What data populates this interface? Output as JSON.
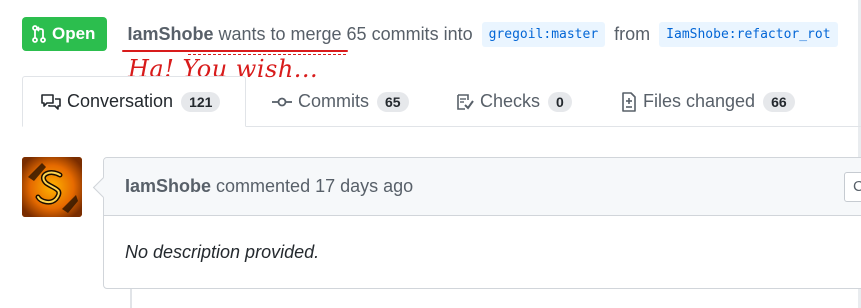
{
  "pr": {
    "state_label": "Open",
    "author": "IamShobe",
    "merge_text": "wants to merge 65 commits into",
    "base_branch": "gregoil:master",
    "from_text": "from",
    "head_branch": "IamShobe:refactor_rot"
  },
  "annotation": {
    "text": "Ha! You wish...",
    "color": "#d81b1b"
  },
  "tabs": [
    {
      "label": "Conversation",
      "count": "121",
      "icon": "comment-discussion-icon",
      "selected": true
    },
    {
      "label": "Commits",
      "count": "65",
      "icon": "git-commit-icon",
      "selected": false
    },
    {
      "label": "Checks",
      "count": "0",
      "icon": "checklist-icon",
      "selected": false
    },
    {
      "label": "Files changed",
      "count": "66",
      "icon": "file-diff-icon",
      "selected": false
    }
  ],
  "comment": {
    "author": "IamShobe",
    "action": "commented",
    "time": "17 days ago",
    "body": "No description provided.",
    "side_button": "C"
  },
  "colors": {
    "open_green": "#2cbe4e",
    "branch_blue": "#0366d6",
    "branch_bg": "#eaf5ff"
  }
}
